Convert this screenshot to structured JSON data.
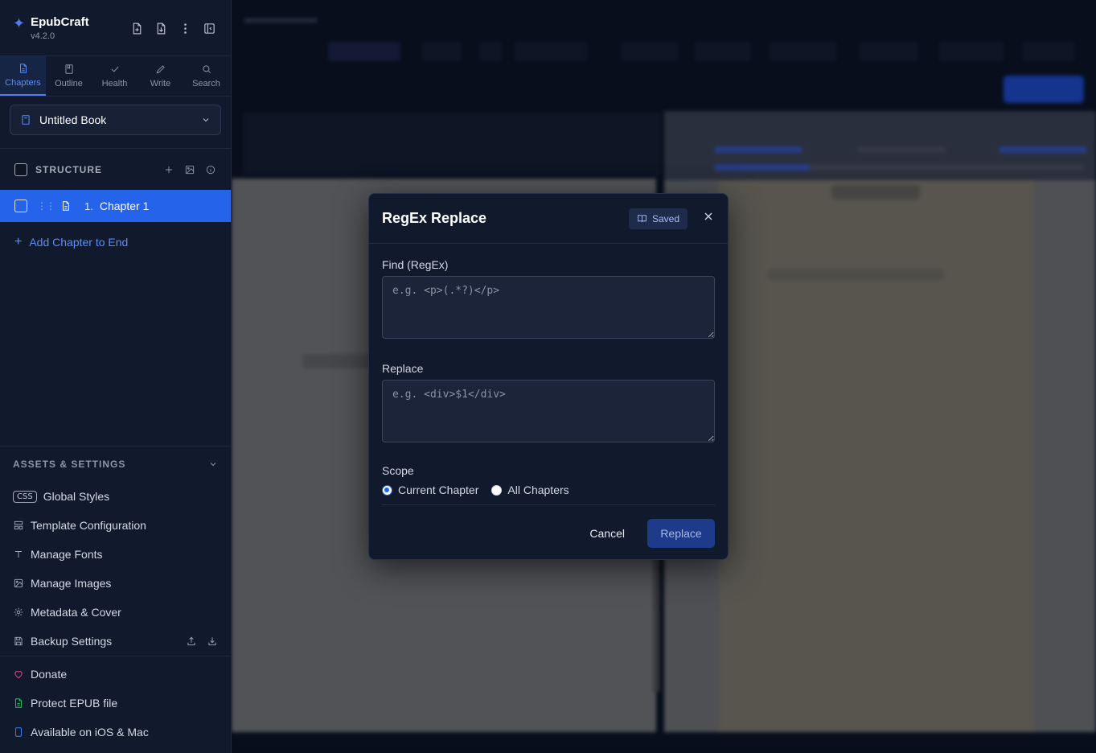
{
  "app": {
    "name": "EpubCraft",
    "version": "v4.2.0"
  },
  "tabs": [
    {
      "label": "Chapters",
      "icon": "file-icon"
    },
    {
      "label": "Outline",
      "icon": "bookmark-icon"
    },
    {
      "label": "Health",
      "icon": "check-icon"
    },
    {
      "label": "Write",
      "icon": "pen-icon"
    },
    {
      "label": "Search",
      "icon": "search-icon"
    }
  ],
  "book": {
    "selected": "Untitled Book"
  },
  "structure": {
    "title": "STRUCTURE",
    "chapters": [
      {
        "number": "1.",
        "title": "Chapter 1"
      }
    ],
    "add_label": "Add Chapter to End"
  },
  "assets": {
    "title": "ASSETS & SETTINGS",
    "css_badge": "CSS",
    "items": [
      "Global Styles",
      "Template Configuration",
      "Manage Fonts",
      "Manage Images",
      "Metadata & Cover",
      "Backup Settings"
    ]
  },
  "footer": {
    "donate": "Donate",
    "protect": "Protect EPUB file",
    "available": "Available on iOS & Mac"
  },
  "colors": {
    "accent": "#2563eb",
    "donate": "#ec4899",
    "protect": "#22c55e"
  },
  "modal": {
    "title": "RegEx Replace",
    "saved_label": "Saved",
    "find_label": "Find (RegEx)",
    "find_placeholder": "e.g. <p>(.*?)</p>",
    "replace_label": "Replace",
    "replace_placeholder": "e.g. <div>$1</div>",
    "scope_label": "Scope",
    "scope_options": [
      "Current Chapter",
      "All Chapters"
    ],
    "scope_selected": "Current Chapter",
    "cancel_label": "Cancel",
    "replace_button": "Replace"
  }
}
